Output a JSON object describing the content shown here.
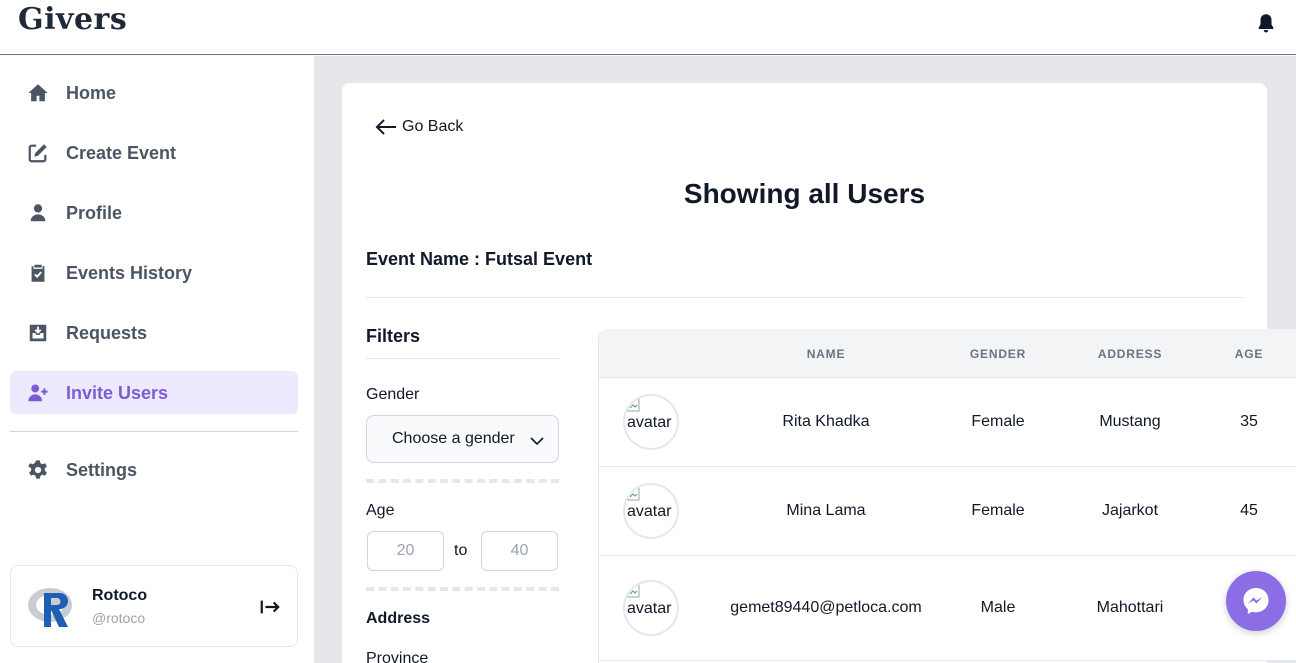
{
  "header": {
    "brand": "Givers",
    "notifications_icon": "bell-icon"
  },
  "sidebar": {
    "items": [
      {
        "label": "Home",
        "icon": "home-icon",
        "active": false
      },
      {
        "label": "Create Event",
        "icon": "edit-icon",
        "active": false
      },
      {
        "label": "Profile",
        "icon": "user-icon",
        "active": false
      },
      {
        "label": "Events History",
        "icon": "clipboard-check-icon",
        "active": false
      },
      {
        "label": "Requests",
        "icon": "inbox-download-icon",
        "active": false
      },
      {
        "label": "Invite Users",
        "icon": "user-plus-icon",
        "active": true
      }
    ],
    "settings": {
      "label": "Settings",
      "icon": "gear-icon"
    },
    "user": {
      "name": "Rotoco",
      "handle": "@rotoco",
      "logout_icon": "logout-icon"
    }
  },
  "main": {
    "back_label": "Go Back",
    "title": "Showing all Users",
    "event_name": "Event Name : Futsal Event",
    "filters": {
      "title": "Filters",
      "gender_label": "Gender",
      "gender_value": "Choose a gender",
      "age_label": "Age",
      "age_min": "20",
      "age_to": "to",
      "age_max": "40",
      "address_label": "Address",
      "province_label": "Province"
    },
    "table": {
      "columns": [
        "NAME",
        "GENDER",
        "ADDRESS",
        "AGE"
      ],
      "avatar_alt": "avatar",
      "rows": [
        {
          "name": "Rita Khadka",
          "gender": "Female",
          "address": "Mustang",
          "age": "35"
        },
        {
          "name": "Mina Lama",
          "gender": "Female",
          "address": "Jajarkot",
          "age": "45"
        },
        {
          "name": "gemet89440@petloca.com",
          "gender": "Male",
          "address": "Mahottari",
          "age": ""
        }
      ]
    }
  },
  "colors": {
    "accent": "#7c5cd6",
    "active_bg": "#ede9fe",
    "messenger": "#8b6ee6"
  }
}
